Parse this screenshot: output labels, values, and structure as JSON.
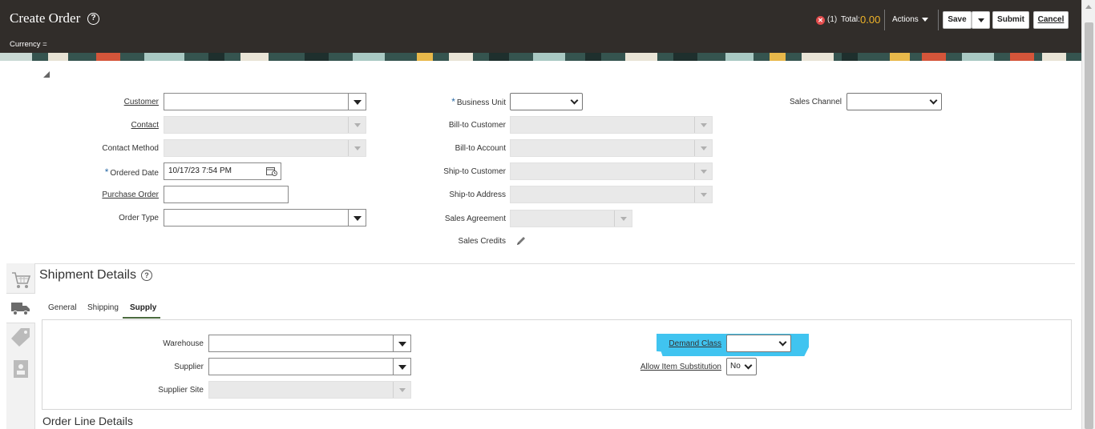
{
  "header": {
    "title": "Create Order",
    "currency_label": "Currency =",
    "error_count": "(1)",
    "total_label": "Total:",
    "total_value": "0.00",
    "actions_label": "Actions",
    "save_label": "Save",
    "submit_label": "Submit",
    "cancel_label": "Cancel"
  },
  "form": {
    "customer": {
      "label": "Customer",
      "value": ""
    },
    "contact": {
      "label": "Contact",
      "value": ""
    },
    "contact_method": {
      "label": "Contact Method",
      "value": ""
    },
    "ordered_date": {
      "label": "Ordered Date",
      "value": "10/17/23 7:54 PM"
    },
    "purchase_order": {
      "label": "Purchase Order",
      "value": ""
    },
    "order_type": {
      "label": "Order Type",
      "value": ""
    },
    "business_unit": {
      "label": "Business Unit",
      "value": ""
    },
    "bill_to_customer": {
      "label": "Bill-to Customer",
      "value": ""
    },
    "bill_to_account": {
      "label": "Bill-to Account",
      "value": ""
    },
    "ship_to_customer": {
      "label": "Ship-to Customer",
      "value": ""
    },
    "ship_to_address": {
      "label": "Ship-to Address",
      "value": ""
    },
    "sales_agreement": {
      "label": "Sales Agreement",
      "value": ""
    },
    "sales_credits": {
      "label": "Sales Credits"
    },
    "sales_channel": {
      "label": "Sales Channel",
      "value": ""
    }
  },
  "shipment": {
    "title": "Shipment Details",
    "tabs": [
      {
        "label": "General"
      },
      {
        "label": "Shipping"
      },
      {
        "label": "Supply"
      }
    ],
    "selected_tab": "Supply",
    "warehouse": {
      "label": "Warehouse",
      "value": ""
    },
    "supplier": {
      "label": "Supplier",
      "value": ""
    },
    "supplier_site": {
      "label": "Supplier Site",
      "value": ""
    },
    "demand_class": {
      "label": "Demand Class",
      "value": ""
    },
    "allow_item_substitution": {
      "label": "Allow Item Substitution",
      "value": "No"
    }
  },
  "order_line_details": {
    "title": "Order Line Details"
  },
  "colors": {
    "header_bg": "#312d2a",
    "total_value": "#f0b429",
    "highlight": "#40c4f0",
    "error": "#e34d4d"
  }
}
